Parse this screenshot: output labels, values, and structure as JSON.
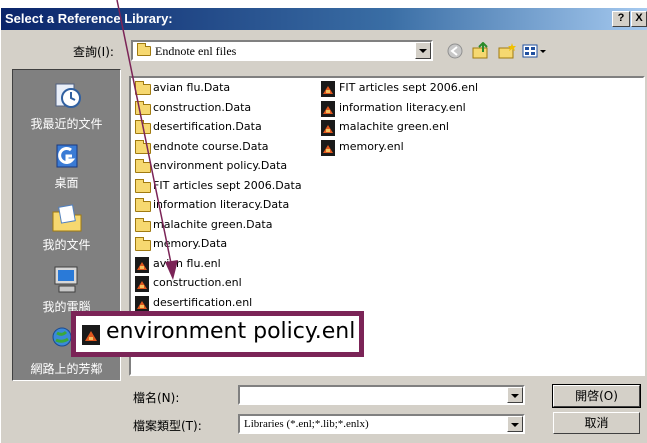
{
  "dialog": {
    "title": "Select a Reference Library:",
    "help_label": "?",
    "close_label": "X"
  },
  "lookin": {
    "label": "查詢(I):",
    "value": "Endnote enl files"
  },
  "places": [
    {
      "label": "我最近的文件",
      "icon": "recent-documents-icon"
    },
    {
      "label": "桌面",
      "icon": "desktop-icon"
    },
    {
      "label": "我的文件",
      "icon": "my-documents-icon"
    },
    {
      "label": "我的電腦",
      "icon": "my-computer-icon"
    },
    {
      "label": "網路上的芳鄰",
      "icon": "network-icon"
    }
  ],
  "files_col1": [
    {
      "name": "avian flu.Data",
      "type": "folder"
    },
    {
      "name": "construction.Data",
      "type": "folder"
    },
    {
      "name": "desertification.Data",
      "type": "folder"
    },
    {
      "name": "endnote course.Data",
      "type": "folder"
    },
    {
      "name": "environment policy.Data",
      "type": "folder"
    },
    {
      "name": "FIT articles sept 2006.Data",
      "type": "folder"
    },
    {
      "name": "information literacy.Data",
      "type": "folder"
    },
    {
      "name": "malachite green.Data",
      "type": "folder"
    },
    {
      "name": "memory.Data",
      "type": "folder"
    },
    {
      "name": "avian flu.enl",
      "type": "enl"
    },
    {
      "name": "construction.enl",
      "type": "enl"
    },
    {
      "name": "desertification.enl",
      "type": "enl"
    }
  ],
  "files_col2": [
    {
      "name": "FIT articles sept 2006.enl",
      "type": "enl"
    },
    {
      "name": "information literacy.enl",
      "type": "enl"
    },
    {
      "name": "malachite green.enl",
      "type": "enl"
    },
    {
      "name": "memory.enl",
      "type": "enl"
    }
  ],
  "callout": {
    "label": "environment policy.enl"
  },
  "filename": {
    "label": "檔名(N):",
    "value": ""
  },
  "filetype": {
    "label": "檔案類型(T):",
    "value": "Libraries (*.enl;*.lib;*.enlx)"
  },
  "buttons": {
    "open": "開啓(O)",
    "cancel": "取消"
  },
  "colors": {
    "title_bar": "#0a246a",
    "callout_border": "#7b2457",
    "arrow": "#7b2457"
  }
}
